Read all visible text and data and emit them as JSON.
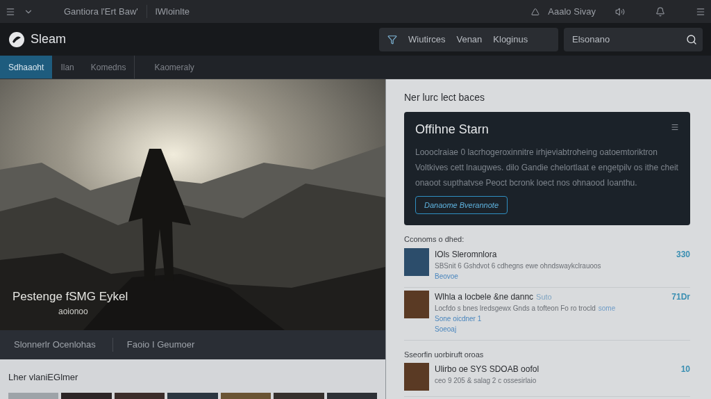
{
  "top_bar": {
    "items": [
      "Gantiora l'Ert Baw'",
      "lWloinlte"
    ],
    "account": "Aaalo Sivay"
  },
  "header": {
    "logo": "Sleam",
    "nav": [
      "Wiutirces",
      "Venan",
      "Kloginus"
    ],
    "search": {
      "value": "Elsonano"
    }
  },
  "tabs": [
    {
      "label": "Sdhaaoht",
      "selected": true
    },
    {
      "label": "Ilan",
      "selected": false
    },
    {
      "label": "Komedns",
      "selected": false
    },
    {
      "label": "Kaomeraly",
      "selected": false
    }
  ],
  "hero": {
    "title": "Pestenge fSMG Eykel",
    "subtitle": "aoionoo"
  },
  "hero_bar": [
    "Slonnerlr Ocenlohas",
    "Faoio I Geumoer"
  ],
  "library": {
    "heading": "Lher vlaniEGlmer"
  },
  "side": {
    "heading": "Ner lurc lect baces",
    "card": {
      "title": "Offihne Starn",
      "body": "Loooclraiae 0 lacrhogeroxinnitre irhjeviabtroheing oatoemtoriktron Voltkives cett lnaugwes. dilo Gandie chelortlaat e engetpilv os ithe cheit onaoot supthatvse Peoct bcronk loect nos ohnaood Ioanthu.",
      "button": "Danaome Bverannote"
    },
    "sections": [
      {
        "heading": "Cconoms o dhed:",
        "items": [
          {
            "title": "IOls Sleromnlora",
            "desc": "SBSnit 6 Gshdvot 6 cdhegns ewe ohndswaykclrauoos",
            "links": [
              "Beovoe"
            ],
            "count": "330"
          },
          {
            "title": "Wlhla a locbele &ne dannc",
            "note": "Suto",
            "desc": "Locfdo s bnes lredsgewx Gnds a tofteon Fo ro trocld",
            "desc_link": "some",
            "links": [
              "Sone oicdner 1",
              "Soeoaj"
            ],
            "count": "71Dr"
          }
        ]
      },
      {
        "heading": "Sseorfin uorbiruft oroas",
        "items": [
          {
            "title": "Ulirbo oe SYS SDOAB oofol",
            "desc": "ceo 9 205 & salag 2 c ossesirlaio",
            "count": "10"
          }
        ]
      }
    ]
  }
}
